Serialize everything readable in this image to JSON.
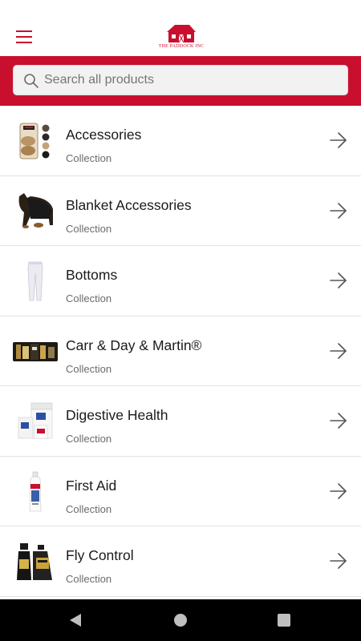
{
  "header": {
    "logo_text": "THE PADDOCK INC",
    "accent_color": "#c8102e"
  },
  "search": {
    "placeholder": "Search all products",
    "value": ""
  },
  "collections": [
    {
      "title": "Accessories",
      "subtitle": "Collection",
      "thumb_icon": "accessories-thumbnail"
    },
    {
      "title": "Blanket Accessories",
      "subtitle": "Collection",
      "thumb_icon": "horse-blanket-thumbnail"
    },
    {
      "title": "Bottoms",
      "subtitle": "Collection",
      "thumb_icon": "riding-pants-thumbnail"
    },
    {
      "title": "Carr & Day & Martin®",
      "subtitle": "Collection",
      "thumb_icon": "carr-day-martin-banner-thumbnail"
    },
    {
      "title": "Digestive Health",
      "subtitle": "Collection",
      "thumb_icon": "supplement-tubs-thumbnail"
    },
    {
      "title": "First Aid",
      "subtitle": "Collection",
      "thumb_icon": "spray-bottle-thumbnail"
    },
    {
      "title": "Fly Control",
      "subtitle": "Collection",
      "thumb_icon": "fly-spray-bottles-thumbnail"
    }
  ],
  "icons": {
    "menu": "hamburger-menu-icon",
    "search": "search-icon",
    "row_arrow": "arrow-right-icon",
    "nav_back": "back-triangle-icon",
    "nav_home": "home-circle-icon",
    "nav_recent": "recent-apps-square-icon"
  }
}
